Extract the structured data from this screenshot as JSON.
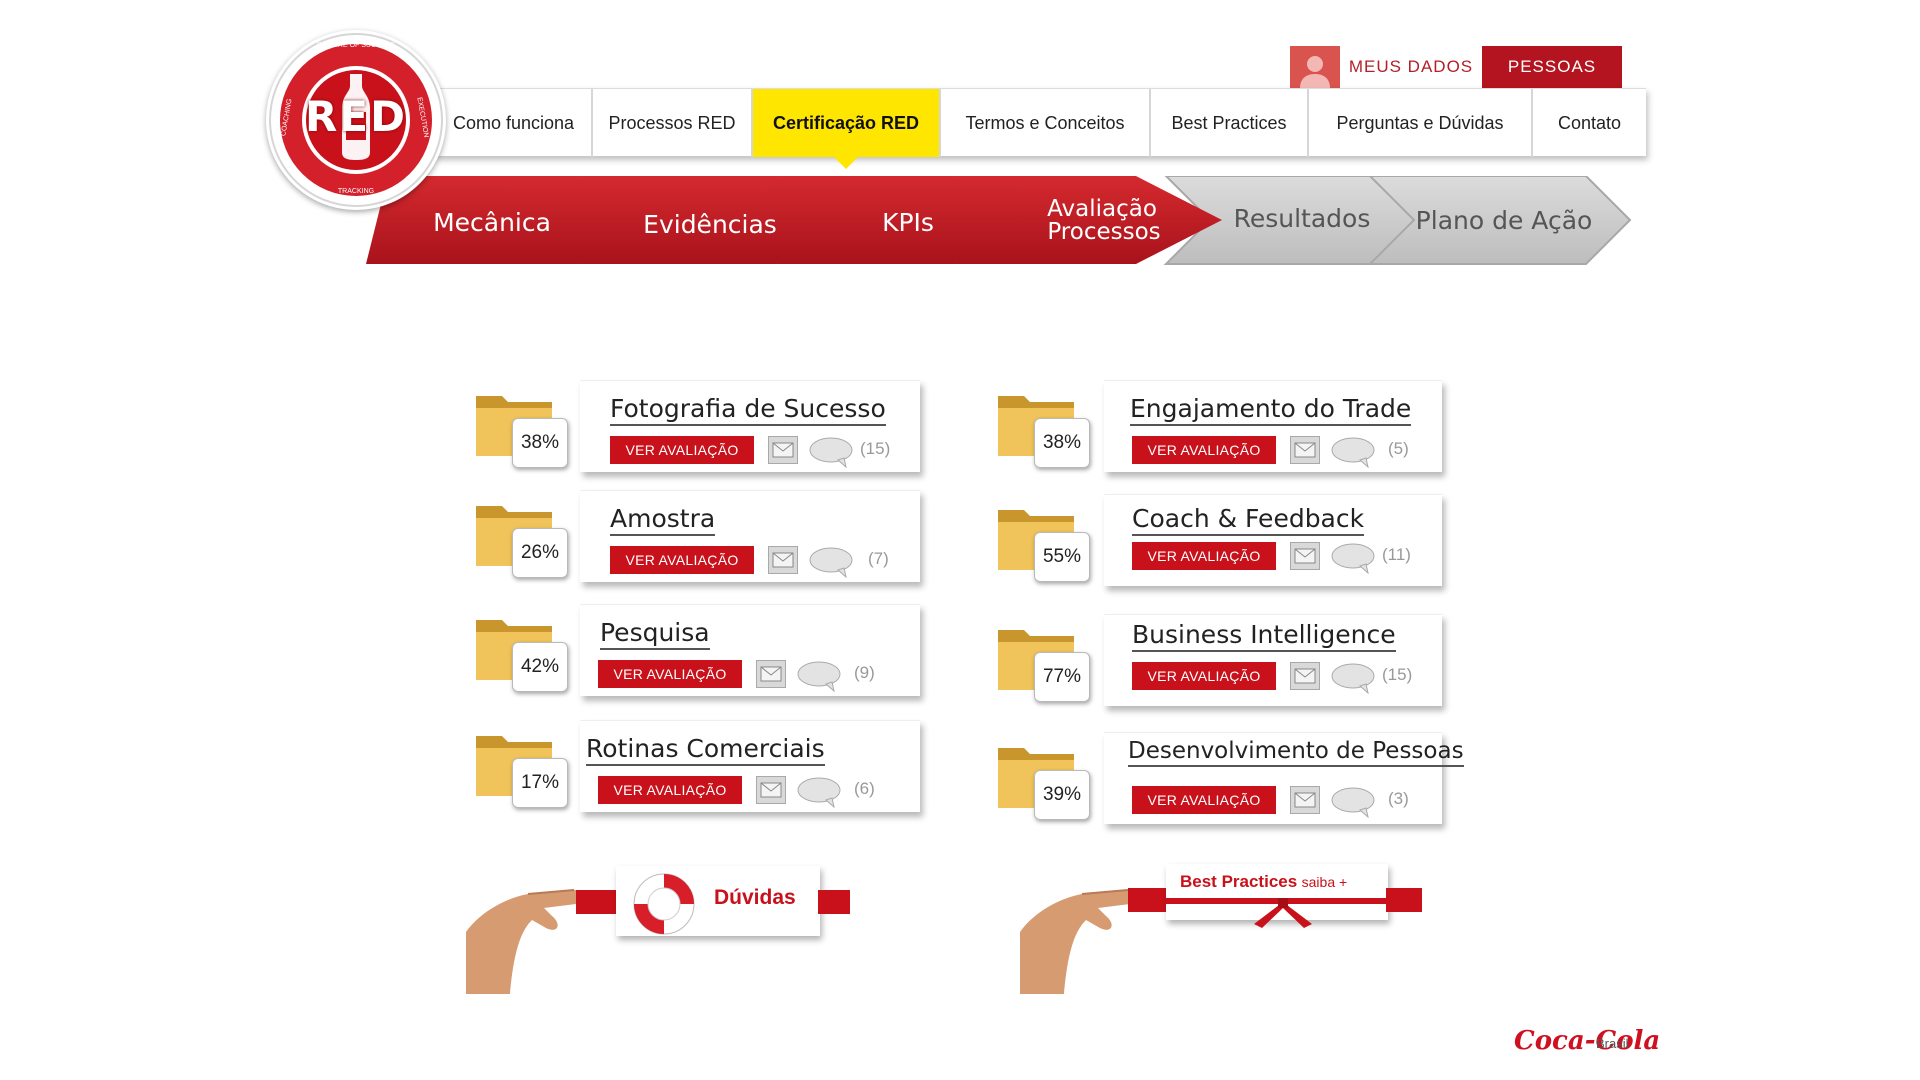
{
  "user": {
    "meus_dados": "MEUS DADOS",
    "pessoas": "PESSOAS"
  },
  "nav": {
    "items": [
      {
        "label": "Como funciona"
      },
      {
        "label": "Processos RED"
      },
      {
        "label": "Certificação RED",
        "active": true
      },
      {
        "label": "Termos e Conceitos"
      },
      {
        "label": "Best Practices"
      },
      {
        "label": "Perguntas e Dúvidas"
      },
      {
        "label": "Contato"
      }
    ]
  },
  "logo": {
    "text": "RED",
    "ring_top": "PICTURE OF SUCCESS",
    "ring_right": "EXECUTION",
    "ring_bottom": "TRACKING",
    "ring_left": "COACHING"
  },
  "process": {
    "steps": [
      {
        "label": "Mecânica",
        "state": "done"
      },
      {
        "label": "Evidências",
        "state": "done"
      },
      {
        "label": "KPIs",
        "state": "done"
      },
      {
        "label": "Avaliação Processos",
        "line1": "Avaliação",
        "line2": "Processos",
        "state": "done"
      },
      {
        "label": "Resultados",
        "state": "pending"
      },
      {
        "label": "Plano de Ação",
        "state": "pending"
      }
    ]
  },
  "cards": {
    "ver_label": "VER AVALIAÇÃO",
    "left": [
      {
        "title": "Fotografia de Sucesso",
        "percent": "38%",
        "comments": "(15)"
      },
      {
        "title": "Amostra",
        "percent": "26%",
        "comments": "(7)"
      },
      {
        "title": "Pesquisa",
        "percent": "42%",
        "comments": "(9)"
      },
      {
        "title": "Rotinas Comerciais",
        "percent": "17%",
        "comments": "(6)"
      }
    ],
    "right": [
      {
        "title": "Engajamento do Trade",
        "percent": "38%",
        "comments": "(5)"
      },
      {
        "title": "Coach & Feedback",
        "percent": "55%",
        "comments": "(11)"
      },
      {
        "title": "Business Intelligence",
        "percent": "77%",
        "comments": "(15)"
      },
      {
        "title": "Desenvolvimento de Pessoas",
        "percent": "39%",
        "comments": "(3)"
      }
    ]
  },
  "banners": {
    "duvidas": "Dúvidas",
    "best_practices": "Best Practices",
    "saiba": "saiba +"
  },
  "footer": {
    "brand": "Coca-Cola",
    "country": "Brasil"
  },
  "colors": {
    "red": "#c8111b",
    "dark_red": "#b3141f",
    "yellow": "#ffe600",
    "grey_step": "#cfcfcf"
  }
}
